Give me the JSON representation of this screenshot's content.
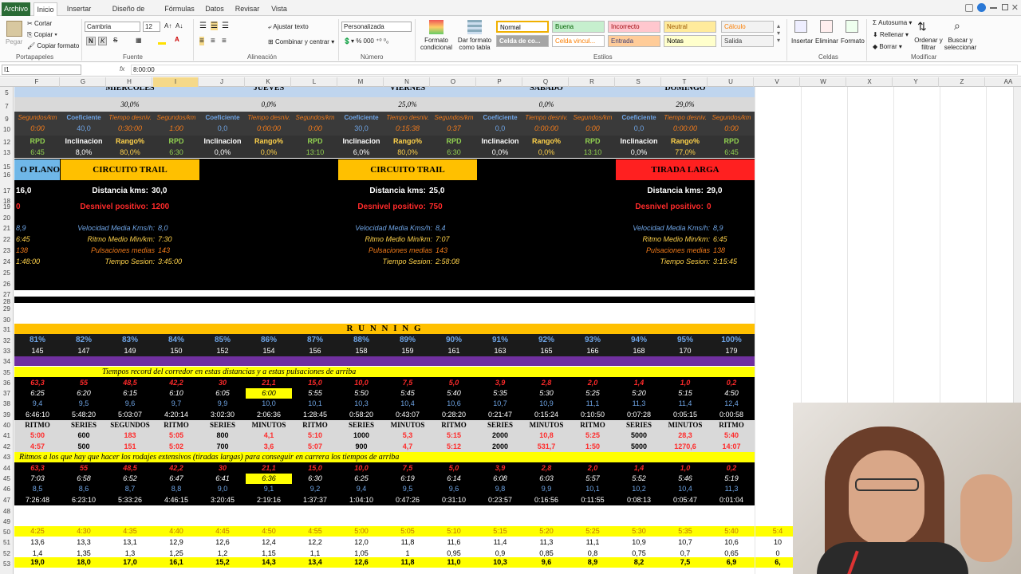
{
  "tabs": [
    "Archivo",
    "Inicio",
    "Insertar",
    "Diseño de página",
    "Fórmulas",
    "Datos",
    "Revisar",
    "Vista"
  ],
  "ribbon": {
    "clipboard": {
      "paste": "Pegar",
      "cut": "Cortar",
      "copy": "Copiar",
      "format_painter": "Copiar formato",
      "group": "Portapapeles"
    },
    "font": {
      "name": "Cambria",
      "size": "12",
      "bold": "N",
      "italic": "K",
      "strike": "S",
      "group": "Fuente"
    },
    "alignment": {
      "wrap": "Ajustar texto",
      "merge": "Combinar y centrar",
      "group": "Alineación"
    },
    "number": {
      "format": "Personalizada",
      "group": "Número"
    },
    "styles": {
      "cond": "Formato condicional",
      "table": "Dar formato como tabla",
      "normal": "Normal",
      "good": "Buena",
      "bad": "Incorrecto",
      "neutral": "Neutral",
      "calc": "Cálculo",
      "check": "Celda de co...",
      "linked": "Celda vincul...",
      "input": "Entrada",
      "notes": "Notas",
      "output": "Salida",
      "group": "Estilos"
    },
    "cells": {
      "insert": "Insertar",
      "delete": "Eliminar",
      "format": "Formato",
      "group": "Celdas"
    },
    "editing": {
      "autosum": "Autosuma",
      "fill": "Rellenar",
      "clear": "Borrar",
      "sort": "Ordenar y filtrar",
      "find": "Buscar y seleccionar",
      "group": "Modificar"
    }
  },
  "formula_bar": {
    "name_box": "I1",
    "fx": "fx",
    "value": "8:00:00"
  },
  "columns": [
    "F",
    "G",
    "H",
    "I",
    "J",
    "K",
    "L",
    "M",
    "N",
    "O",
    "P",
    "Q",
    "R",
    "S",
    "T",
    "U",
    "V",
    "W",
    "X",
    "Y",
    "Z",
    "AA"
  ],
  "rows": [
    "5",
    "7",
    "9",
    "10",
    "12",
    "13",
    "15",
    "16",
    "17",
    "18",
    "19",
    "20",
    "21",
    "22",
    "23",
    "24",
    "25",
    "26",
    "27",
    "28",
    "29",
    "30",
    "31",
    "32",
    "33",
    "34",
    "35",
    "36",
    "37",
    "38",
    "39",
    "40",
    "41",
    "42",
    "43",
    "44",
    "45",
    "46",
    "47",
    "48",
    "49",
    "50",
    "51",
    "52",
    "53"
  ],
  "days": [
    "MIERCOLES",
    "JUEVES",
    "VIERNES",
    "SABADO",
    "DOMINGO"
  ],
  "day_pct": [
    "30,0%",
    "0,0%",
    "25,0%",
    "0,0%",
    "29,0%"
  ],
  "row9_labels": [
    "Segundos/km",
    "Coeficiente",
    "Tiempo desniv.",
    "Segundos/km"
  ],
  "row10": [
    [
      "0:00"
    ],
    [
      "40,0",
      "0:30:00",
      "1:00"
    ],
    [
      "0,0",
      "0:00:00",
      "0:00"
    ],
    [
      "30,0",
      "0:15:38",
      "0:37"
    ],
    [
      "0,0",
      "0:00:00",
      "0:00"
    ],
    [
      "0,0",
      "0:00:00",
      "0:00"
    ]
  ],
  "row12_labels": [
    "RPD",
    "Inclinacion",
    "Rango%"
  ],
  "row13": [
    [
      "6:45"
    ],
    [
      "8,0%",
      "80,0%",
      "6:30"
    ],
    [
      "0,0%",
      "0,0%",
      "13:10"
    ],
    [
      "6,0%",
      "80,0%",
      "6:30"
    ],
    [
      "0,0%",
      "0,0%",
      "13:10"
    ],
    [
      "0,0%",
      "77,0%",
      "6:45"
    ]
  ],
  "sessions": {
    "left": "O PLANO",
    "wed": "CIRCUITO TRAIL",
    "fri": "CIRCUITO TRAIL",
    "sun": "TIRADA LARGA"
  },
  "dist_label": "Distancia kms:",
  "desn_label": "Desnivel positivo:",
  "left_vals": [
    "16,0",
    "0",
    "8,9",
    "6:45",
    "138",
    "1:48:00"
  ],
  "wed": {
    "dist": "30,0",
    "desn": "1200",
    "vel": "8,0",
    "ritmo": "7:30",
    "puls": "143",
    "tiempo": "3:45:00"
  },
  "fri": {
    "dist": "25,0",
    "desn": "750",
    "vel": "8,4",
    "ritmo": "7:07",
    "puls": "143",
    "tiempo": "2:58:08"
  },
  "sun": {
    "dist": "29,0",
    "desn": "0",
    "vel": "8,9",
    "ritmo": "6:45",
    "puls": "138",
    "tiempo": "3:15:45"
  },
  "stat_labels": [
    "Velocidad Media Kms/h:",
    "Ritmo Medio Min/km:",
    "Pulsaciones medias",
    "Tiempo Sesion:"
  ],
  "running": "R U N N I N G",
  "pct": [
    "81%",
    "82%",
    "83%",
    "84%",
    "85%",
    "86%",
    "87%",
    "88%",
    "89%",
    "90%",
    "91%",
    "92%",
    "93%",
    "94%",
    "95%",
    "100%"
  ],
  "bpm": [
    "145",
    "147",
    "149",
    "150",
    "152",
    "154",
    "156",
    "158",
    "159",
    "161",
    "163",
    "165",
    "166",
    "168",
    "170",
    "179"
  ],
  "record_title": "Tiempos record del corredor en estas distancias y a estas pulsaciones de arriba",
  "r36": [
    "63,3",
    "55",
    "48,5",
    "42,2",
    "30",
    "21,1",
    "15,0",
    "10,0",
    "7,5",
    "5,0",
    "3,9",
    "2,8",
    "2,0",
    "1,4",
    "1,0",
    "0,2"
  ],
  "r37": [
    "6:25",
    "6:20",
    "6:15",
    "6:10",
    "6:05",
    "6:00",
    "5:55",
    "5:50",
    "5:45",
    "5:40",
    "5:35",
    "5:30",
    "5:25",
    "5:20",
    "5:15",
    "4:50"
  ],
  "r38": [
    "9,4",
    "9,5",
    "9,6",
    "9,7",
    "9,9",
    "10,0",
    "10,1",
    "10,3",
    "10,4",
    "10,6",
    "10,7",
    "10,9",
    "11,1",
    "11,3",
    "11,4",
    "12,4"
  ],
  "r39": [
    "6:46:10",
    "5:48:20",
    "5:03:07",
    "4:20:14",
    "3:02:30",
    "2:06:36",
    "1:28:45",
    "0:58:20",
    "0:43:07",
    "0:28:20",
    "0:21:47",
    "0:15:24",
    "0:10:50",
    "0:07:28",
    "0:05:15",
    "0:00:58"
  ],
  "r40": [
    "RITMO",
    "SERIES",
    "SEGUNDOS",
    "RITMO",
    "SERIES",
    "MINUTOS",
    "RITMO",
    "SERIES",
    "MINUTOS",
    "RITMO",
    "SERIES",
    "MINUTOS",
    "RITMO",
    "SERIES",
    "MINUTOS",
    "RITMO"
  ],
  "r41": [
    "5:00",
    "600",
    "183",
    "5:05",
    "800",
    "4,1",
    "5:10",
    "1000",
    "5,3",
    "5:15",
    "2000",
    "10,8",
    "5:25",
    "5000",
    "28,3",
    "5:40"
  ],
  "r42": [
    "4:57",
    "500",
    "151",
    "5:02",
    "700",
    "3,6",
    "5:07",
    "900",
    "4,7",
    "5:12",
    "2000",
    "531,7",
    "1:50",
    "5000",
    "1270,6",
    "14:07"
  ],
  "extensive_title": "Ritmos a los que hay que hacer los rodajes extensivos (tiradas largas) para conseguir en carrera los tiempos de arriba",
  "r44": [
    "63,3",
    "55",
    "48,5",
    "42,2",
    "30",
    "21,1",
    "15,0",
    "10,0",
    "7,5",
    "5,0",
    "3,9",
    "2,8",
    "2,0",
    "1,4",
    "1,0",
    "0,2"
  ],
  "r45": [
    "7:03",
    "6:58",
    "6:52",
    "6:47",
    "6:41",
    "6:36",
    "6:30",
    "6:25",
    "6:19",
    "6:14",
    "6:08",
    "6:03",
    "5:57",
    "5:52",
    "5:46",
    "5:19"
  ],
  "r46": [
    "8,5",
    "8,6",
    "8,7",
    "8,8",
    "9,0",
    "9,1",
    "9,2",
    "9,4",
    "9,5",
    "9,6",
    "9,8",
    "9,9",
    "10,1",
    "10,2",
    "10,4",
    "11,3"
  ],
  "r47": [
    "7:26:48",
    "6:23:10",
    "5:33:26",
    "4:46:15",
    "3:20:45",
    "2:19:16",
    "1:37:37",
    "1:04:10",
    "0:47:26",
    "0:31:10",
    "0:23:57",
    "0:16:56",
    "0:11:55",
    "0:08:13",
    "0:05:47",
    "0:01:04"
  ],
  "r50": [
    "4:25",
    "4:30",
    "4:35",
    "4:40",
    "4:45",
    "4:50",
    "4:55",
    "5:00",
    "5:05",
    "5:10",
    "5:15",
    "5:20",
    "5:25",
    "5:30",
    "5:35",
    "5:40",
    "5:4"
  ],
  "r51": [
    "13,6",
    "13,3",
    "13,1",
    "12,9",
    "12,6",
    "12,4",
    "12,2",
    "12,0",
    "11,8",
    "11,6",
    "11,4",
    "11,3",
    "11,1",
    "10,9",
    "10,7",
    "10,6",
    "10"
  ],
  "r52": [
    "1,4",
    "1,35",
    "1,3",
    "1,25",
    "1,2",
    "1,15",
    "1,1",
    "1,05",
    "1",
    "0,95",
    "0,9",
    "0,85",
    "0,8",
    "0,75",
    "0,7",
    "0,65",
    "0"
  ],
  "r53": [
    "19,0",
    "18,0",
    "17,0",
    "16,1",
    "15,2",
    "14,3",
    "13,4",
    "12,6",
    "11,8",
    "11,0",
    "10,3",
    "9,6",
    "8,9",
    "8,2",
    "7,5",
    "6,9",
    "6,"
  ]
}
